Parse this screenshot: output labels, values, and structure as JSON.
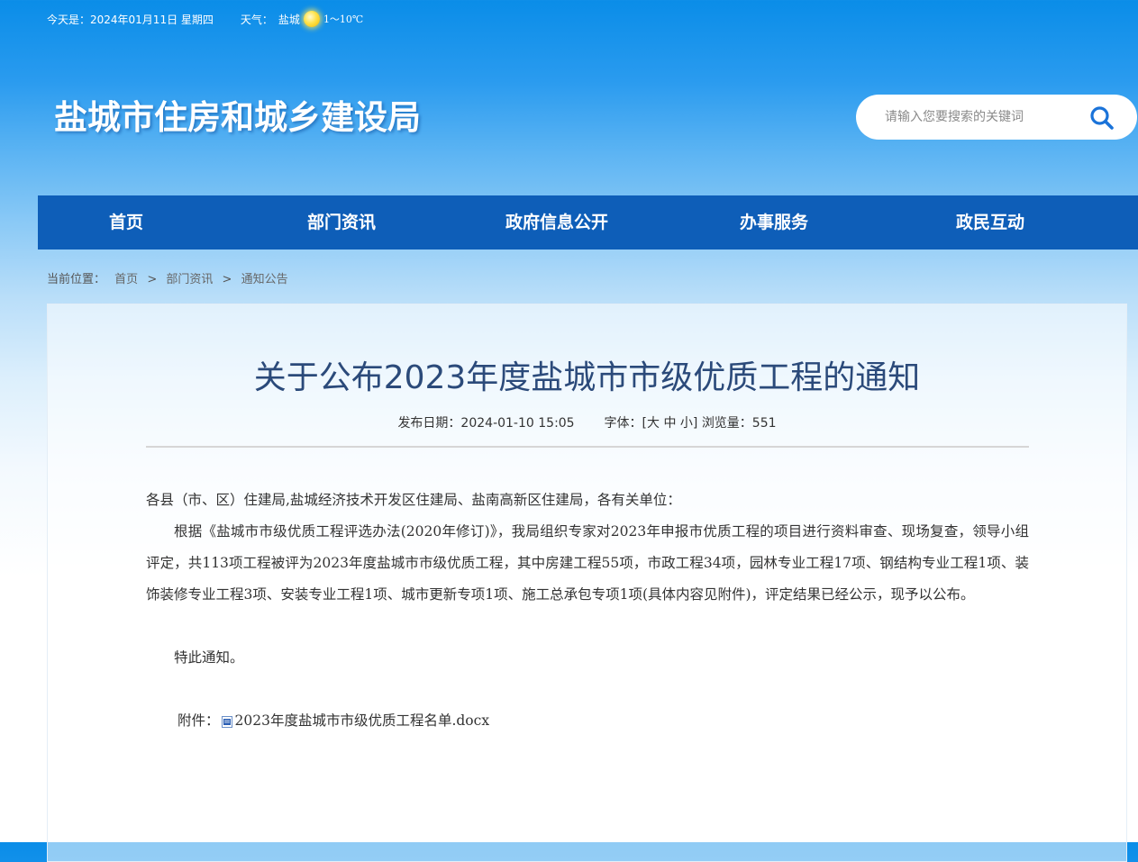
{
  "topbar": {
    "date_text": "今天是：2024年01月11日 星期四",
    "weather_label": "天气：",
    "city": "盐城",
    "weather_icon": "sun-icon",
    "temperature": "1～10℃"
  },
  "header": {
    "site_title": "盐城市住房和城乡建设局",
    "search": {
      "placeholder": "请输入您要搜索的关键词",
      "value": "",
      "icon": "search-icon"
    }
  },
  "nav": {
    "items": [
      {
        "label": "首页"
      },
      {
        "label": "部门资讯"
      },
      {
        "label": "政府信息公开"
      },
      {
        "label": "办事服务"
      },
      {
        "label": "政民互动"
      }
    ]
  },
  "breadcrumb": {
    "label": "当前位置：",
    "items": [
      {
        "label": "首页"
      },
      {
        "label": "部门资讯"
      },
      {
        "label": "通知公告"
      }
    ],
    "separator": ">"
  },
  "article": {
    "title": "关于公布2023年度盐城市市级优质工程的通知",
    "meta": {
      "publish_date": "发布日期：2024-01-10 15:05",
      "font_label": "字体：[",
      "font_large": "大",
      "font_medium": "中",
      "font_small": "小",
      "font_close": "]",
      "views": "浏览量：551"
    },
    "salutation": "各县（市、区）住建局,盐城经济技术开发区住建局、盐南高新区住建局，各有关单位：",
    "paragraph": "根据《盐城市市级优质工程评选办法(2020年修订)》，我局组织专家对2023年申报市优质工程的项目进行资料审查、现场复查，领导小组评定，共113项工程被评为2023年度盐城市市级优质工程，其中房建工程55项，市政工程34项，园林专业工程17项、钢结构专业工程1项、装饰装修专业工程3项、安装专业工程1项、城市更新专项1项、施工总承包专项1项(具体内容见附件)，评定结果已经公示，现予以公布。",
    "closing": "特此通知。",
    "attachment": {
      "label": "附件：",
      "icon": "word-doc-icon",
      "filename": "2023年度盐城市市级优质工程名单.docx"
    }
  },
  "colors": {
    "nav_bg": "#0e5eb8",
    "title_text": "#2b4a7a",
    "header_top": "#0a8de8"
  }
}
